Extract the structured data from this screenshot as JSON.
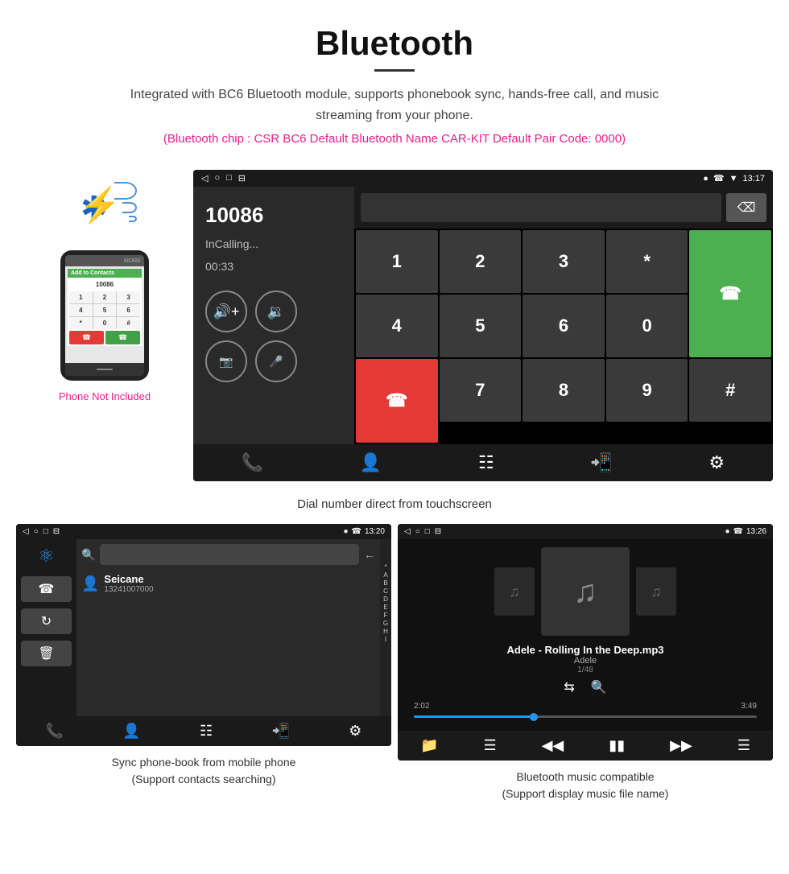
{
  "header": {
    "title": "Bluetooth",
    "description": "Integrated with BC6 Bluetooth module, supports phonebook sync, hands-free call, and music streaming from your phone.",
    "specs": "(Bluetooth chip : CSR BC6    Default Bluetooth Name CAR-KIT    Default Pair Code: 0000)"
  },
  "phone_side": {
    "not_included": "Phone Not Included"
  },
  "car_screen": {
    "status_bar": {
      "left": [
        "◁",
        "○",
        "□",
        "⊟"
      ],
      "right_time": "13:17",
      "right_icons": [
        "📍",
        "📞",
        "▼"
      ]
    },
    "call": {
      "number": "10086",
      "status": "InCalling...",
      "timer": "00:33"
    },
    "numpad": [
      "1",
      "2",
      "3",
      "*",
      "4",
      "5",
      "6",
      "0",
      "7",
      "8",
      "9",
      "#"
    ]
  },
  "main_caption": "Dial number direct from touchscreen",
  "phonebook_screen": {
    "status_bar": {
      "left": [
        "◁",
        "○",
        "□",
        "⊟"
      ],
      "right_time": "13:20"
    },
    "contact": {
      "name": "Seicane",
      "number": "13241007000"
    },
    "alpha_list": [
      "*",
      "A",
      "B",
      "C",
      "D",
      "E",
      "F",
      "G",
      "H",
      "I"
    ]
  },
  "phonebook_caption_line1": "Sync phone-book from mobile phone",
  "phonebook_caption_line2": "(Support contacts searching)",
  "music_screen": {
    "status_bar": {
      "left": [
        "◁",
        "○",
        "□",
        "⊟"
      ],
      "right_time": "13:26"
    },
    "track": {
      "name": "Adele - Rolling In the Deep.mp3",
      "artist": "Adele",
      "count": "1/48"
    },
    "time_current": "2:02",
    "time_total": "3:49"
  },
  "music_caption_line1": "Bluetooth music compatible",
  "music_caption_line2": "(Support display music file name)",
  "nav_icons": {
    "calls": "📞",
    "contacts": "👤",
    "dialpad": "⌨",
    "transfer": "📲",
    "settings": "⚙"
  }
}
